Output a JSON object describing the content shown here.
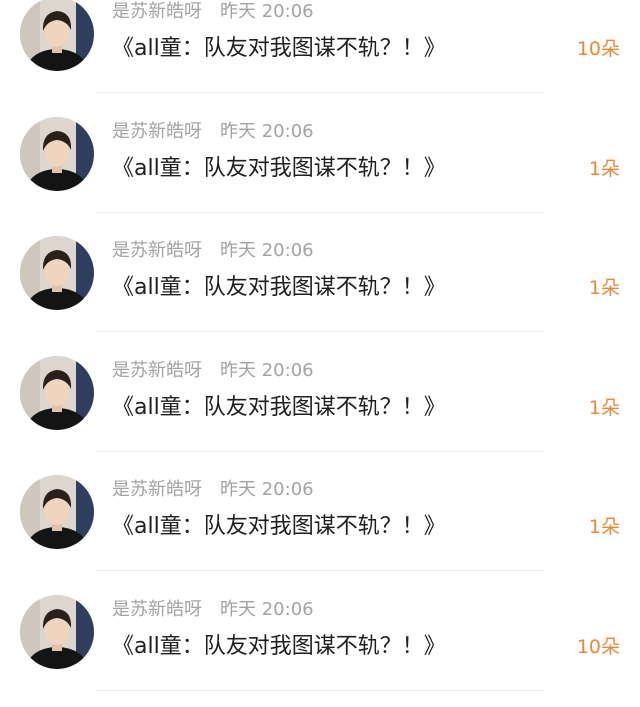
{
  "list": {
    "items": [
      {
        "username": "是苏新皓呀",
        "time": "昨天 20:06",
        "title": "《all童：队友对我图谋不轨？！》",
        "count": "10朵"
      },
      {
        "username": "是苏新皓呀",
        "time": "昨天 20:06",
        "title": "《all童：队友对我图谋不轨？！》",
        "count": "1朵"
      },
      {
        "username": "是苏新皓呀",
        "time": "昨天 20:06",
        "title": "《all童：队友对我图谋不轨？！》",
        "count": "1朵"
      },
      {
        "username": "是苏新皓呀",
        "time": "昨天 20:06",
        "title": "《all童：队友对我图谋不轨？！》",
        "count": "1朵"
      },
      {
        "username": "是苏新皓呀",
        "time": "昨天 20:06",
        "title": "《all童：队友对我图谋不轨？！》",
        "count": "1朵"
      },
      {
        "username": "是苏新皓呀",
        "time": "昨天 20:06",
        "title": "《all童：队友对我图谋不轨？！》",
        "count": "10朵"
      }
    ]
  },
  "colors": {
    "count_accent": "#e9893a",
    "meta_gray": "#a3a3a3",
    "title_text": "#1f1f1f"
  },
  "icons": {
    "avatar": "avatar-photo"
  }
}
